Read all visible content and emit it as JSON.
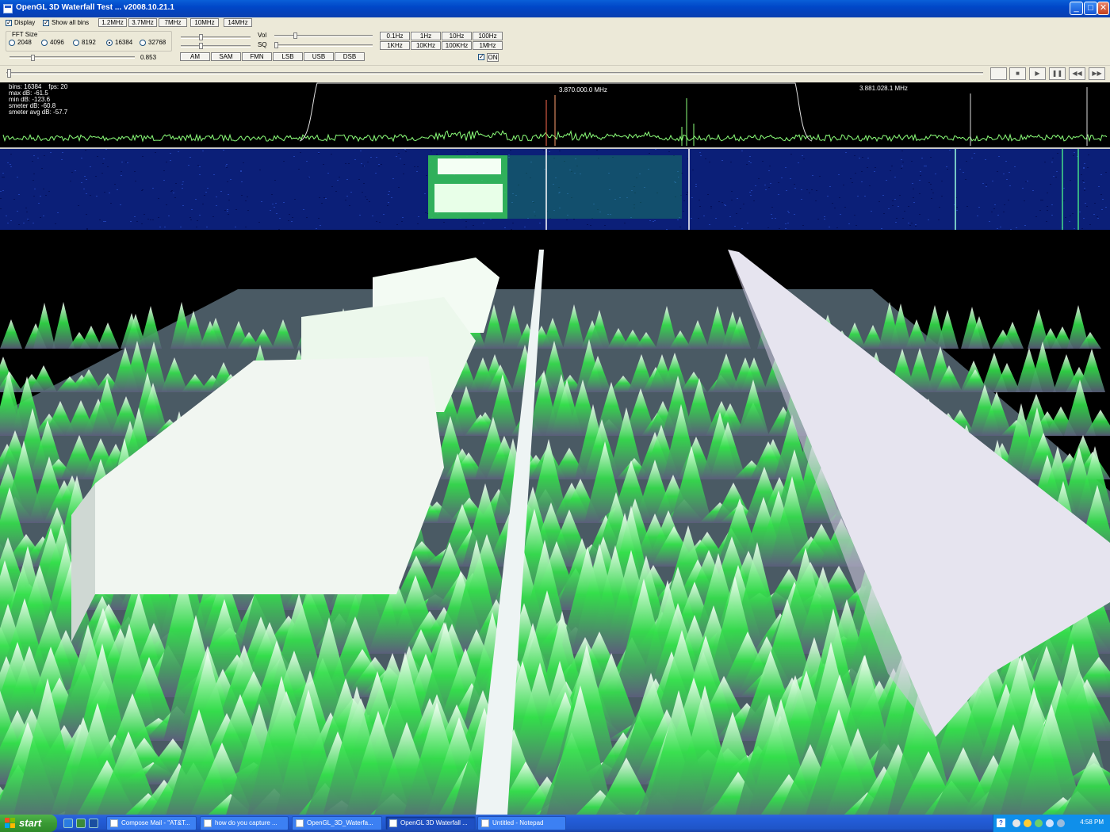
{
  "window": {
    "title": "OpenGL 3D Waterfall Test ... v2008.10.21.1",
    "controls": {
      "minimize": "_",
      "maximize": "□",
      "close": "✕"
    }
  },
  "toolbar": {
    "display_label": "Display",
    "display_checked": "✓",
    "show_all_bins_label": "Show all bins",
    "show_all_bins_checked": "✓",
    "band_buttons": [
      "1.2MHz",
      "3.7MHz",
      "7MHz",
      "10MHz",
      "14MHz"
    ],
    "fft_size": {
      "label": "FFT Size",
      "options": [
        "2048",
        "4096",
        "8192",
        "16384",
        "32768"
      ],
      "selected": "16384"
    },
    "slider_value": "0.853",
    "vol_label": "Vol",
    "sq_label": "SQ",
    "mode_buttons": [
      "AM",
      "SAM",
      "FMN",
      "LSB",
      "USB",
      "DSB"
    ],
    "step_buttons_row1": [
      "0.1Hz",
      "1Hz",
      "10Hz",
      "100Hz"
    ],
    "step_buttons_row2": [
      "1KHz",
      "10KHz",
      "100KHz",
      "1MHz"
    ],
    "on_checked": "✓",
    "on_label": "ON"
  },
  "transport": {
    "buttons": [
      "■",
      "▶",
      "❚❚",
      "◀◀",
      "▶▶"
    ]
  },
  "spectrum": {
    "stats": {
      "bins": "bins: 16384    fps: 20",
      "max_db": "max dB: -61.5",
      "min_db": "min dB: -123.6",
      "smeter_db": "smeter dB: -60.8",
      "smeter_avg_db": "smeter avg dB: -57.7"
    },
    "center_freq": "3.870.000.0 MHz",
    "cursor_freq": "3.881.028.1 MHz"
  },
  "taskbar": {
    "start_label": "start",
    "tasks": [
      {
        "label": "Compose Mail - \"AT&T...",
        "active": false
      },
      {
        "label": "how do you capture ...",
        "active": false
      },
      {
        "label": "OpenGL_3D_Waterfa...",
        "active": false
      },
      {
        "label": "OpenGL 3D Waterfall ...",
        "active": true
      },
      {
        "label": "Untitled - Notepad",
        "active": false
      }
    ],
    "clock": "4:58 PM",
    "help_icon": "?"
  },
  "colors": {
    "accent": "#0a5fd8",
    "spectrum_trace": "#8cff7a",
    "waterfall_bg": "#0b1f78",
    "terrain_peak": "#ffffff",
    "terrain_green": "#33e04a",
    "terrain_base": "#5a5e7a",
    "taskbar": "#245edb",
    "start": "#3a9a34"
  }
}
